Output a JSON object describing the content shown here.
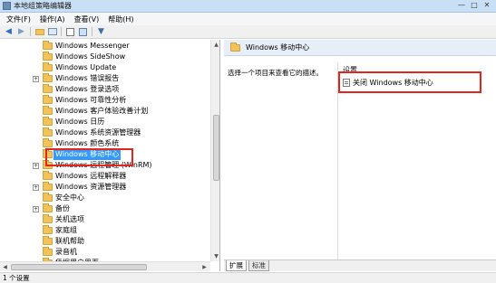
{
  "window": {
    "title": "本地组策略编辑器",
    "min": "—",
    "max": "□",
    "close": "✕"
  },
  "menu": [
    "文件(F)",
    "操作(A)",
    "查看(V)",
    "帮助(H)"
  ],
  "toolbar": {
    "icons": [
      "back-icon",
      "forward-icon",
      "up-folder-icon",
      "show-hide-tree-icon",
      "properties-icon",
      "help-icon",
      "filter-icon"
    ]
  },
  "tree": {
    "items": [
      {
        "label": "Windows Messenger",
        "expandable": false
      },
      {
        "label": "Windows SideShow",
        "expandable": false
      },
      {
        "label": "Windows Update",
        "expandable": false
      },
      {
        "label": "Windows 错误报告",
        "expandable": true
      },
      {
        "label": "Windows 登录选项",
        "expandable": false
      },
      {
        "label": "Windows 可靠性分析",
        "expandable": false
      },
      {
        "label": "Windows 客户体验改善计划",
        "expandable": false
      },
      {
        "label": "Windows 日历",
        "expandable": false
      },
      {
        "label": "Windows 系统资源管理器",
        "expandable": false
      },
      {
        "label": "Windows 颜色系统",
        "expandable": false
      },
      {
        "label": "Windows 移动中心",
        "expandable": false,
        "selected": true
      },
      {
        "label": "Windows 远程管理 (WinRM)",
        "expandable": true
      },
      {
        "label": "Windows 远程解释器",
        "expandable": false
      },
      {
        "label": "Windows 资源管理器",
        "expandable": true
      },
      {
        "label": "安全中心",
        "expandable": false
      },
      {
        "label": "备份",
        "expandable": true
      },
      {
        "label": "关机选项",
        "expandable": false
      },
      {
        "label": "家庭组",
        "expandable": false
      },
      {
        "label": "联机帮助",
        "expandable": false
      },
      {
        "label": "录音机",
        "expandable": false
      },
      {
        "label": "凭据用户界面",
        "expandable": false
      }
    ]
  },
  "right": {
    "header_title": "Windows 移动中心",
    "description": "选择一个项目来查看它的描述。",
    "settings_header": "设置",
    "settings": [
      {
        "label": "关闭 Windows 移动中心"
      }
    ],
    "tabs": [
      "扩展",
      "标准"
    ]
  },
  "status": {
    "text": "1 个设置"
  },
  "colors": {
    "selection": "#3399ff",
    "highlight": "#e2261d",
    "folder": "#f1c35b"
  }
}
